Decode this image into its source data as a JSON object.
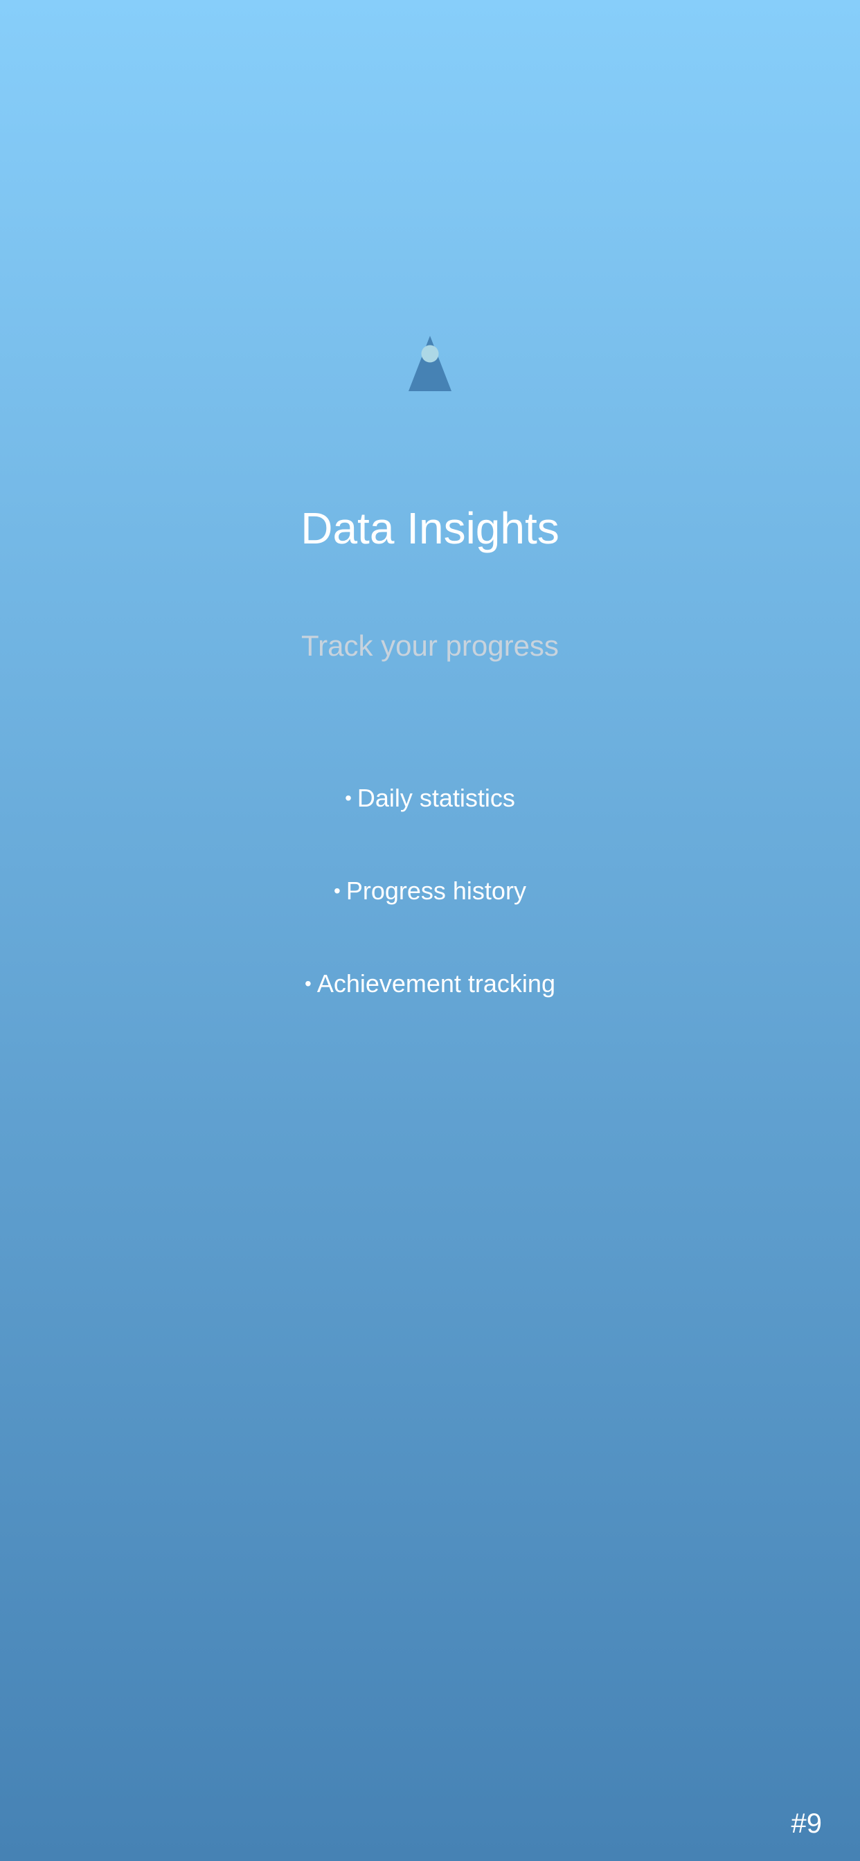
{
  "screen": {
    "title": "Data Insights",
    "subtitle": "Track your progress",
    "features": [
      {
        "bullet": "•",
        "label": "Daily statistics"
      },
      {
        "bullet": "•",
        "label": "Progress history"
      },
      {
        "bullet": "•",
        "label": "Achievement tracking"
      }
    ],
    "page_number": "#9"
  },
  "icons": {
    "logo": "triangle-peak-with-circle-icon"
  },
  "colors": {
    "background_top": "#87cefa",
    "background_bottom": "#4682b4",
    "logo_triangle": "#4682b4",
    "logo_circle": "#add8e6",
    "title": "#ffffff",
    "subtitle": "#c8d3dd",
    "feature_text": "#ffffff"
  }
}
